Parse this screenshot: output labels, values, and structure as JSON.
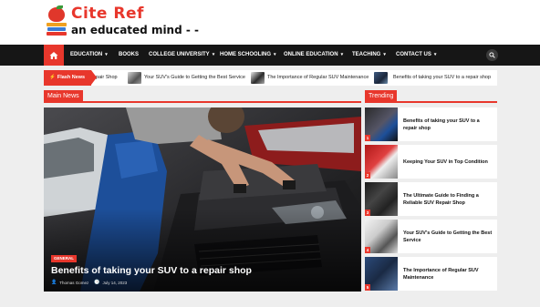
{
  "site": {
    "title": "Cite Ref",
    "tagline": "an educated mind - -"
  },
  "nav": {
    "items": [
      {
        "label": "EDUCATION",
        "caret": "▾"
      },
      {
        "label": "BOOKS",
        "caret": ""
      },
      {
        "label": "COLLEGE UNIVERSITY",
        "caret": "▾"
      },
      {
        "label": "HOME SCHOOLING",
        "caret": "▾"
      },
      {
        "label": "ONLINE EDUCATION",
        "caret": "▾"
      },
      {
        "label": "TEACHING",
        "caret": "▾"
      },
      {
        "label": "CONTACT US",
        "caret": "▾"
      }
    ]
  },
  "flash": {
    "label": "Flash News",
    "items": [
      "Repair Shop",
      "Your SUV's Guide to Getting the Best Service",
      "The Importance of Regular SUV Maintenance",
      "Benefits of taking your SUV to a repair shop"
    ]
  },
  "main_news": {
    "section_title": "Main News",
    "category": "GENERAL",
    "headline": "Benefits of taking your SUV to a repair shop",
    "author": "Thomas Gomez",
    "date": "July 14, 2023"
  },
  "trending": {
    "section_title": "Trending",
    "items": [
      {
        "num": "1",
        "title": "Benefits of taking your SUV to a repair shop"
      },
      {
        "num": "2",
        "title": "Keeping Your SUV in Top Condition"
      },
      {
        "num": "3",
        "title": "The Ultimate Guide to Finding a Reliable SUV Repair Shop"
      },
      {
        "num": "4",
        "title": "Your SUV's Guide to Getting the Best Service"
      },
      {
        "num": "5",
        "title": "The Importance of Regular SUV Maintenance"
      }
    ]
  },
  "colors": {
    "accent": "#e8372c",
    "nav_bg": "#161616",
    "page_bg": "#eeeeee"
  }
}
